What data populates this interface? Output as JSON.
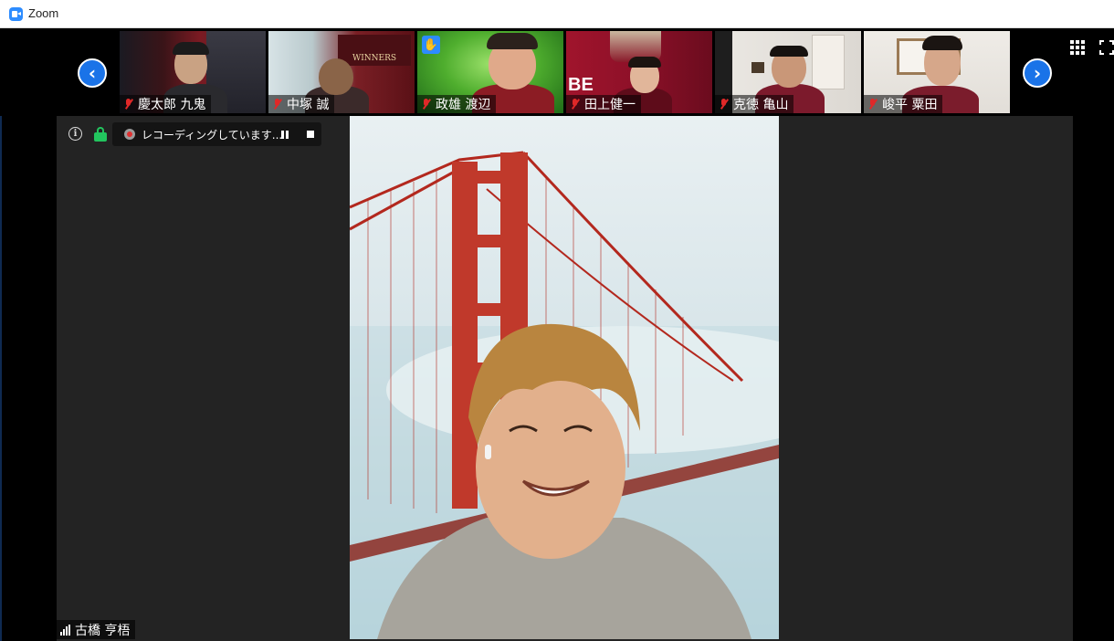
{
  "window": {
    "title": "Zoom"
  },
  "gallery": {
    "participants": [
      {
        "name": "慶太郎 九鬼",
        "muted": true
      },
      {
        "name": "中塚 誠",
        "muted": true
      },
      {
        "name": "政雄 渡辺",
        "muted": true,
        "hand_raised": true
      },
      {
        "name": "田上健一",
        "muted": true
      },
      {
        "name": "克徳 亀山",
        "muted": true
      },
      {
        "name": "峻平 粟田",
        "muted": true
      }
    ],
    "prev_icon": "chevron-left-icon",
    "next_icon": "chevron-right-icon"
  },
  "toolbar": {
    "recording_text": "レコーディングしています...",
    "gallery_view_icon": "grid-icon",
    "fullscreen_icon": "fullscreen-icon"
  },
  "speaker": {
    "name": "古橋 亨梧"
  },
  "colors": {
    "accent": "#1a73e8",
    "muted_mic": "#e02828",
    "lock": "#22c55e",
    "hand": "#2d8cff"
  }
}
